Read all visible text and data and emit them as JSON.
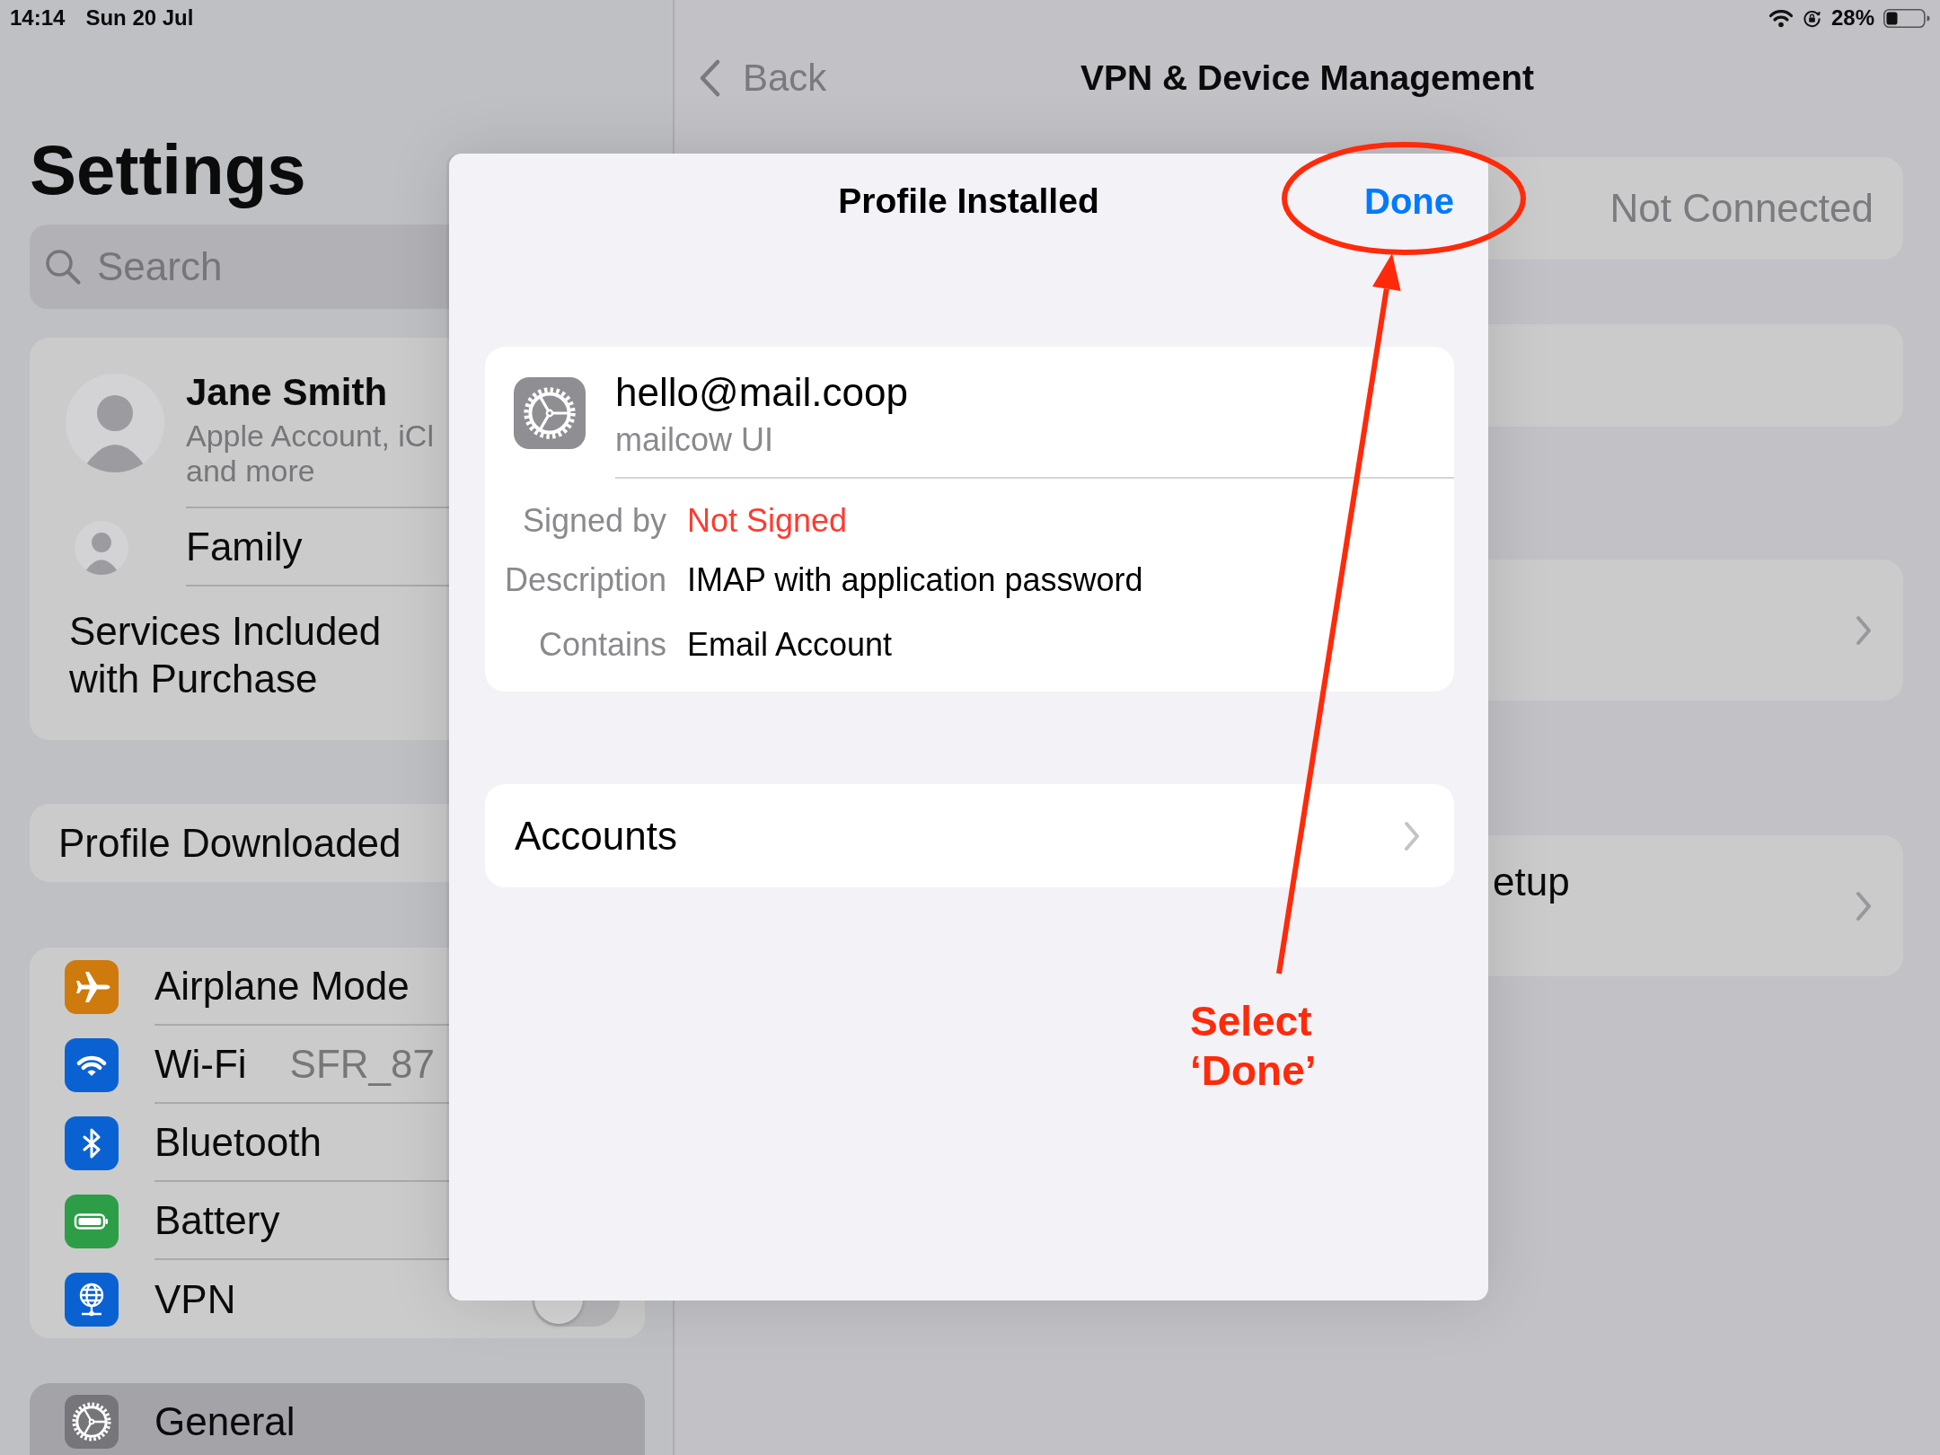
{
  "status_bar": {
    "time": "14:14",
    "date": "Sun 20 Jul",
    "battery": "28%"
  },
  "sidebar": {
    "title": "Settings",
    "search": {
      "placeholder": "Search"
    },
    "account": {
      "name": "Jane Smith",
      "subtitle": [
        "Apple Account, iCl",
        "and more"
      ],
      "family": "Family",
      "services": "Services Included with Purchase"
    },
    "groups": [
      {
        "items": [
          {
            "label": "Profile Downloaded",
            "kind": "plain",
            "selected": false
          }
        ]
      },
      {
        "items": [
          {
            "label": "Airplane Mode",
            "kind": "plain",
            "color": "#cf7a0c",
            "selected": false
          },
          {
            "label": "Wi-Fi",
            "kind": "value",
            "value": "SFR_87",
            "color": "#0a62d2",
            "selected": false
          },
          {
            "label": "Bluetooth",
            "kind": "plain",
            "color": "#0a62d2",
            "selected": false
          },
          {
            "label": "Battery",
            "kind": "plain",
            "color": "#2d9d48",
            "selected": false
          },
          {
            "label": "VPN",
            "kind": "toggle",
            "on": false,
            "color": "#0a62d2",
            "selected": false
          }
        ]
      },
      {
        "items": [
          {
            "label": "General",
            "kind": "plain",
            "color": "#76767a",
            "selected": true
          }
        ]
      }
    ]
  },
  "detail": {
    "back": "Back",
    "title": "VPN & Device Management",
    "rows": [
      {
        "kind": "value",
        "value": "Not Connected"
      },
      {
        "kind": "blank"
      },
      {
        "kind": "link"
      },
      {
        "kind": "link",
        "label": "etup"
      }
    ]
  },
  "sheet": {
    "title": "Profile Installed",
    "done": "Done",
    "profile": {
      "name": "hello@mail.coop",
      "source": "mailcow UI",
      "details": [
        {
          "label": "Signed by",
          "value": "Not Signed",
          "kind": "alert"
        },
        {
          "label": "Description",
          "value": "IMAP with application password",
          "kind": "plain"
        },
        {
          "label": "Contains",
          "value": "Email Account",
          "kind": "plain"
        }
      ]
    },
    "links": [
      {
        "label": "Accounts"
      }
    ]
  },
  "annotation": {
    "text": "Select ‘Done’"
  }
}
